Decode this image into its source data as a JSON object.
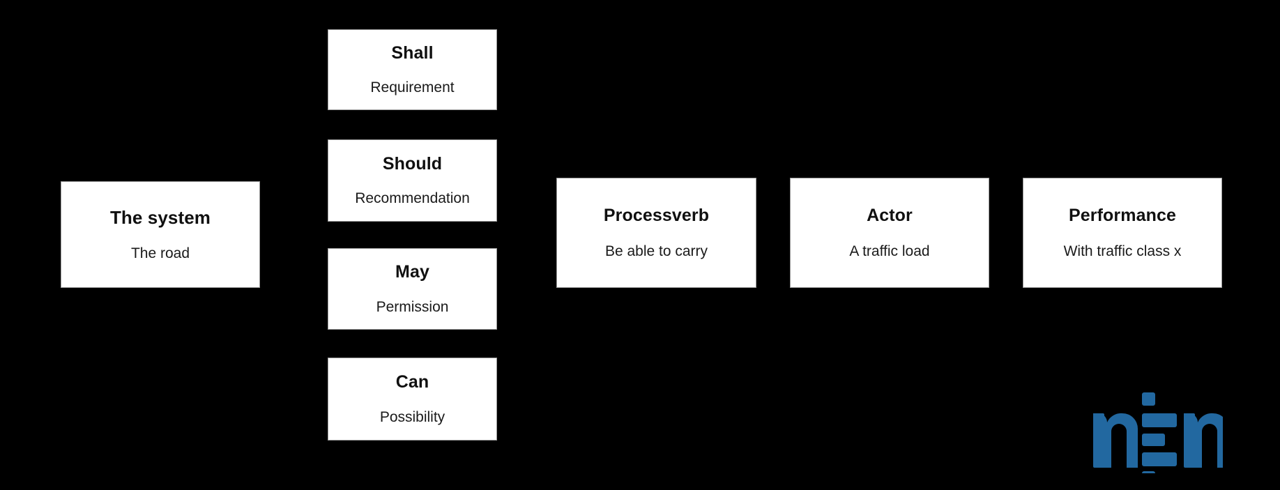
{
  "background_color": "#000000",
  "card_style": {
    "fill": "#ffffff",
    "border": "#9a9a9a",
    "text": "#101010"
  },
  "diagram": {
    "subject": {
      "title": "The system",
      "subtitle": "The road"
    },
    "modal_verbs": [
      {
        "title": "Shall",
        "subtitle": "Requirement"
      },
      {
        "title": "Should",
        "subtitle": "Recommendation"
      },
      {
        "title": "May",
        "subtitle": "Permission"
      },
      {
        "title": "Can",
        "subtitle": "Possibility"
      }
    ],
    "predicate": [
      {
        "title": "Processverb",
        "subtitle": "Be able to carry"
      },
      {
        "title": "Actor",
        "subtitle": "A traffic load"
      },
      {
        "title": "Performance",
        "subtitle": "With traffic class x"
      }
    ]
  },
  "logo": {
    "name": "nen-logo",
    "text": "nen",
    "color": "#2268A0"
  }
}
